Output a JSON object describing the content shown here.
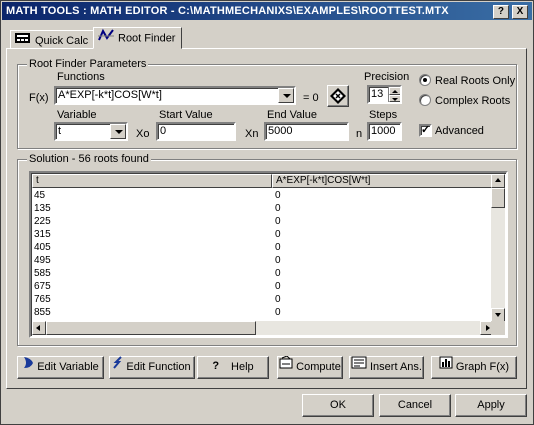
{
  "window": {
    "title": "MATH TOOLS : MATH EDITOR - C:\\MATHMECHANIXS\\EXAMPLES\\ROOTTEST.MTX",
    "help_btn": "?",
    "close_btn": "X"
  },
  "tabs": [
    {
      "label": "Quick Calc",
      "icon": "calculator-icon"
    },
    {
      "label": "Root Finder",
      "icon": "root-finder-icon"
    }
  ],
  "params": {
    "group_label": "Root Finder Parameters",
    "functions_label": "Functions",
    "fx_label": "F(x)",
    "function_value": "A*EXP[-k*t]COS[W*t]",
    "eq_zero": "= 0",
    "precision_label": "Precision",
    "precision_value": "13",
    "variable_label": "Variable",
    "variable_value": "t",
    "xo_label": "Xo",
    "start_label": "Start Value",
    "start_value": "0",
    "xn_label": "Xn",
    "end_label": "End Value",
    "end_value": "5000",
    "n_label": "n",
    "steps_label": "Steps",
    "steps_value": "1000",
    "real_roots": "Real Roots Only",
    "complex_roots": "Complex Roots",
    "advanced": "Advanced",
    "advanced_check": "✓"
  },
  "solution": {
    "group_label": "Solution - 56 roots found",
    "columns": [
      "t",
      "A*EXP[-k*t]COS[W*t]"
    ],
    "rows": [
      [
        "45",
        "0"
      ],
      [
        "135",
        "0"
      ],
      [
        "225",
        "0"
      ],
      [
        "315",
        "0"
      ],
      [
        "405",
        "0"
      ],
      [
        "495",
        "0"
      ],
      [
        "585",
        "0"
      ],
      [
        "675",
        "0"
      ],
      [
        "765",
        "0"
      ],
      [
        "855",
        "0"
      ]
    ]
  },
  "toolbar": {
    "edit_variable": "Edit Variable",
    "edit_function": "Edit Function",
    "help": "Help",
    "compute": "Compute",
    "insert_ans": "Insert Ans.",
    "graph": "Graph F(x)"
  },
  "dialog": {
    "ok": "OK",
    "cancel": "Cancel",
    "apply": "Apply"
  }
}
